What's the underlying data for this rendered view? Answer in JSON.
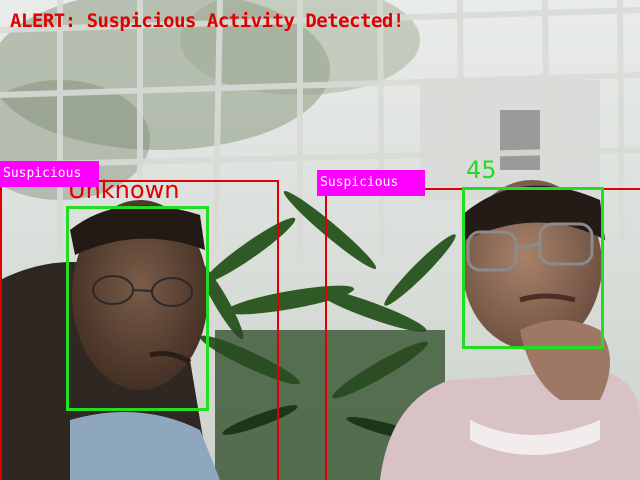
{
  "alert": {
    "text": "ALERT: Suspicious Activity Detected!",
    "color": "#e00000"
  },
  "detections": [
    {
      "person_tag": "Suspicious",
      "face_label": "Unknown",
      "face_label_color": "#e00000"
    },
    {
      "person_tag": "Suspicious",
      "face_label": "45",
      "face_label_color": "#22dd22"
    }
  ],
  "colors": {
    "person_box": "#e00000",
    "face_box": "#22dd22",
    "tag_bg": "#ff00ff",
    "tag_text": "#ffffff"
  }
}
